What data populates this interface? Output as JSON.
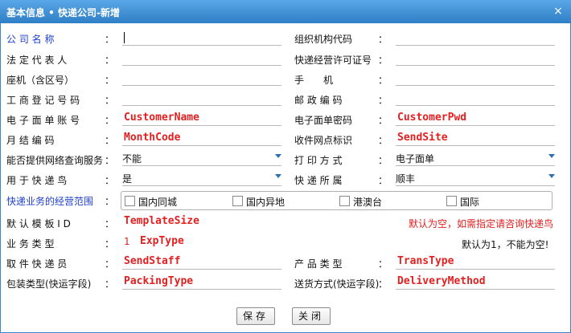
{
  "dialog": {
    "title": "基本信息  •  快递公司-新增",
    "close_glyph": "×"
  },
  "colon": "：",
  "form": {
    "company_name": {
      "label": "公 司 名 称"
    },
    "org_code": {
      "label": "组织机构代码"
    },
    "legal_rep": {
      "label": "法 定 代 表 人"
    },
    "license_no": {
      "label": "快递经营许可证号"
    },
    "landline": {
      "label": "座机（含区号）"
    },
    "mobile": {
      "label": "手　　机"
    },
    "business_reg": {
      "label": "工 商 登 记 号 码"
    },
    "postcode": {
      "label": "邮 政 编 码"
    },
    "eorder_account": {
      "label": "电 子 面 单 账 号",
      "value": "CustomerName"
    },
    "eorder_password": {
      "label": "电子面单密码",
      "value": "CustomerPwd"
    },
    "month_code": {
      "label": "月 结 编 码",
      "value": "MonthCode"
    },
    "send_site": {
      "label": "收件网点标识",
      "value": "SendSite"
    },
    "network_query": {
      "label": "能否提供网络查询服务",
      "value": "不能"
    },
    "print_mode": {
      "label": "打 印 方 式",
      "value": "电子面单"
    },
    "for_kuaidiniao": {
      "label": "用 于 快 递 鸟",
      "value": "是"
    },
    "express_belongs": {
      "label": "快 递 所 属",
      "value": "顺丰"
    },
    "scope": {
      "label": "快递业务的经营范围",
      "options": [
        "国内同城",
        "国内异地",
        "港澳台",
        "国际"
      ]
    },
    "template": {
      "label": "默 认 模 板 I D",
      "value": "TemplateSize",
      "note": "默认为空，如需指定请咨询快递鸟"
    },
    "biz_type": {
      "label": "业 务 类 型",
      "prefix": "1",
      "value": "ExpType",
      "note": "默认为1，不能为空!"
    },
    "pickup": {
      "label": "取 件 快 递 员",
      "value": "SendStaff"
    },
    "product_type": {
      "label": "产 品 类 型",
      "value": "TransType"
    },
    "packing": {
      "label": "包装类型(快运字段)",
      "value": "PackingType"
    },
    "delivery": {
      "label": "送货方式(快运字段)",
      "value": "DeliveryMethod"
    }
  },
  "buttons": {
    "save": "保存",
    "close": "关闭"
  },
  "colors": {
    "titlebar": "#3b8ad4",
    "required_label": "#1f3fd1",
    "placeholder_value": "#e32020"
  }
}
